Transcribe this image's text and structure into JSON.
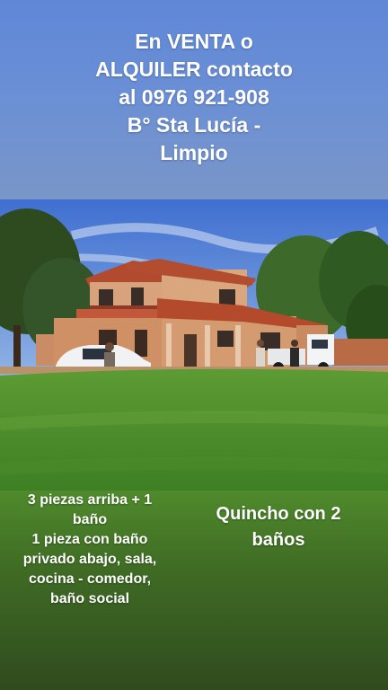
{
  "header": {
    "lines": [
      "En VENTA o",
      "ALQUILER contacto",
      "al 0976 921-908",
      "B° Sta Lucía -",
      "Limpio"
    ]
  },
  "photo": {
    "subject": "two-story-house-with-lawn"
  },
  "description": {
    "left_lines": [
      "3 piezas arriba + 1",
      "baño",
      "1 pieza con baño",
      "privado abajo, sala,",
      "cocina - comedor,",
      "baño social"
    ],
    "right_lines": [
      "Quincho con 2",
      "baños"
    ]
  },
  "colors": {
    "header_bg": "#6a8fd6",
    "footer_bg_top": "#4f8a2c",
    "footer_bg_bottom": "#2f4b1e",
    "text": "#ffffff"
  }
}
